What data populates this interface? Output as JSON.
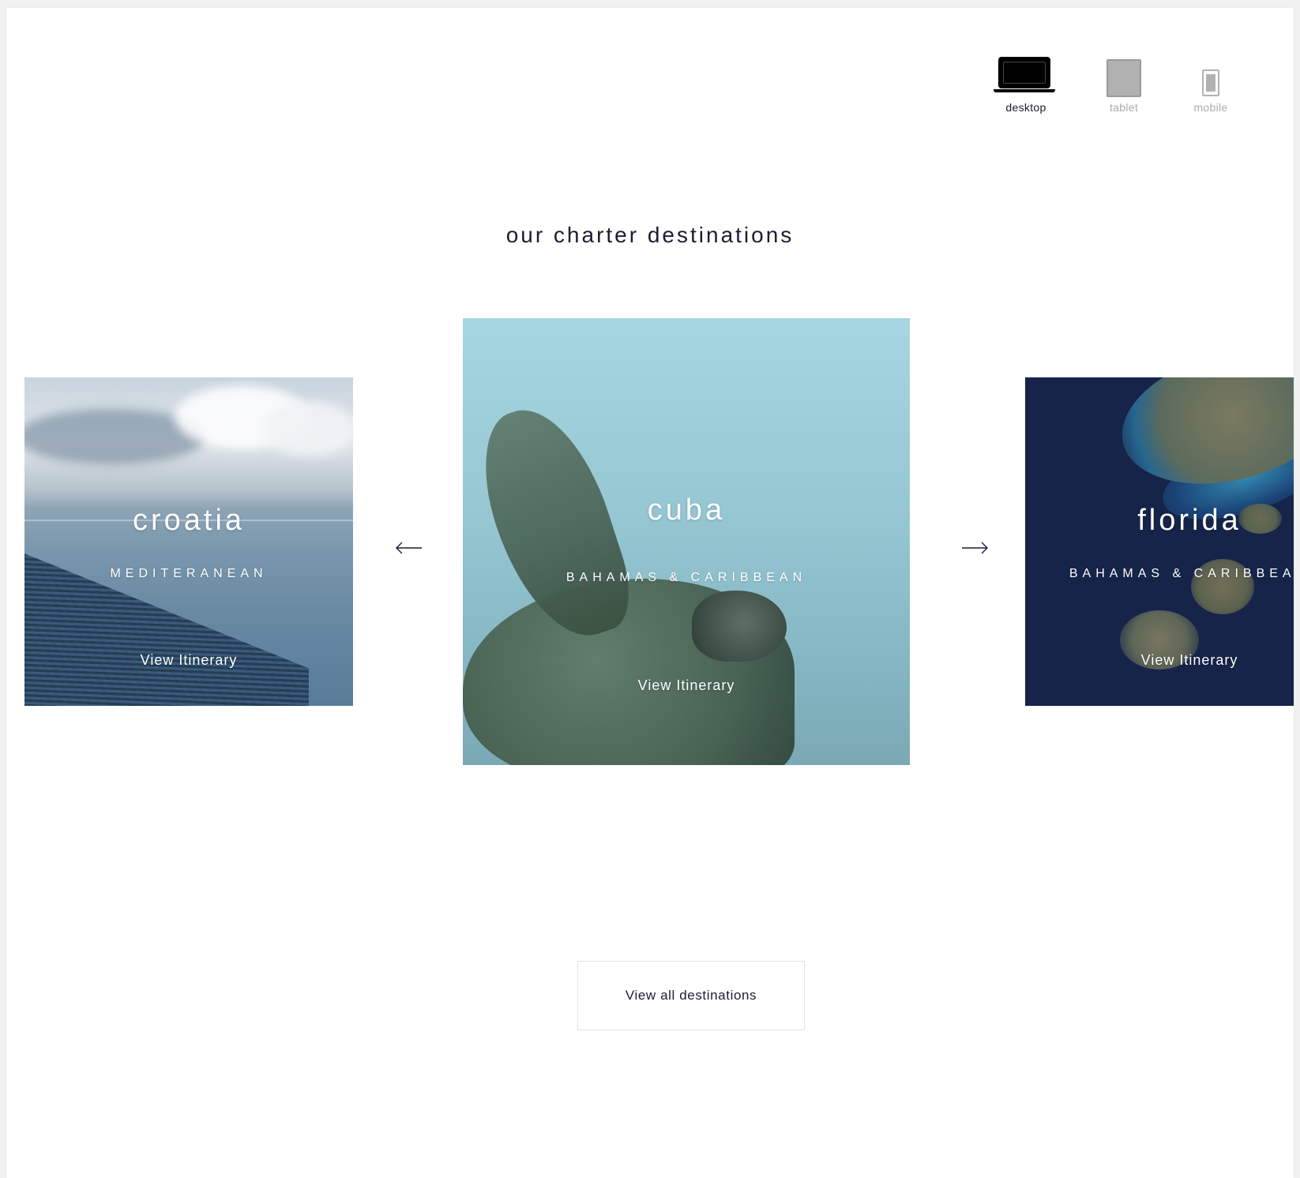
{
  "device_switcher": {
    "items": [
      {
        "label": "desktop",
        "icon": "laptop-icon",
        "active": true
      },
      {
        "label": "tablet",
        "icon": "tablet-icon",
        "active": false
      },
      {
        "label": "mobile",
        "icon": "mobile-icon",
        "active": false
      }
    ]
  },
  "section": {
    "title": "our charter destinations"
  },
  "carousel": {
    "prev_icon": "arrow-left-icon",
    "next_icon": "arrow-right-icon",
    "cards": [
      {
        "name": "croatia",
        "region": "MEDITERANEAN",
        "cta": "View Itinerary"
      },
      {
        "name": "cuba",
        "region": "BAHAMAS & CARIBBEAN",
        "cta": "View Itinerary"
      },
      {
        "name": "florida",
        "region": "BAHAMAS & CARIBBEAN",
        "cta": "View Itinerary"
      }
    ]
  },
  "footer_cta": {
    "label": "View all destinations"
  },
  "colors": {
    "text_dark": "#1a1d33",
    "inactive_gray": "#aaaaaa",
    "florida_bg": "#16244a"
  }
}
